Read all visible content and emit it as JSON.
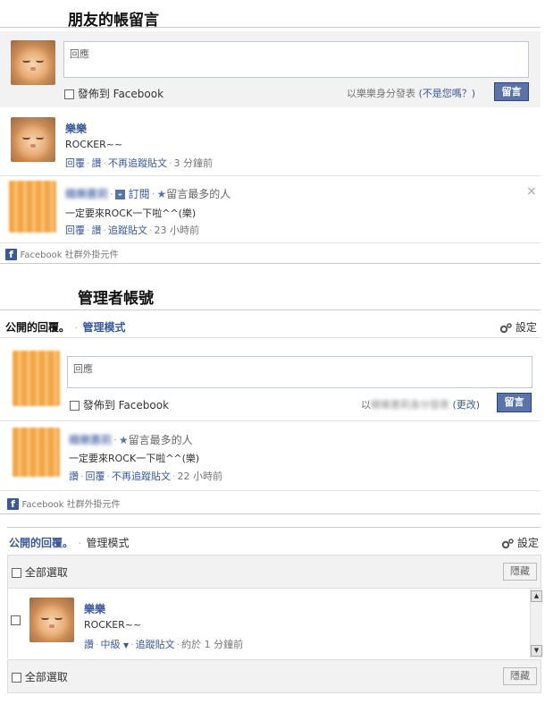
{
  "s1": {
    "title": "朋友的帳留言",
    "input_placeholder": "回應",
    "post_to_fb": "發佈到 Facebook",
    "posting_as": "以樂樂身分發表",
    "not_you": "(不是您嗎？)",
    "submit": "留言",
    "comments": [
      {
        "name": "樂樂",
        "text": "ROCKER~~",
        "actions": [
          "回覆",
          "讚",
          "不再追蹤貼文"
        ],
        "time": "3 分鐘前"
      },
      {
        "name": "韓樂惠莉",
        "subscribe": "訂閱",
        "badge": "留言最多的人",
        "text": "一定要來ROCK一下啦^^(樂)",
        "actions": [
          "回覆",
          "讚",
          "追蹤貼文"
        ],
        "time": "23 小時前"
      }
    ],
    "close": "×",
    "plugin": "Facebook 社群外掛元件"
  },
  "s2": {
    "title": "管理者帳號",
    "tab_public": "公開的回覆。",
    "tab_admin": "管理模式",
    "settings": "設定",
    "input_placeholder": "回應",
    "post_to_fb": "發佈到 Facebook",
    "posting_as_prefix": "以",
    "posting_as_name": "韓樂惠莉身分發表",
    "change": "(更改)",
    "submit": "留言",
    "comment": {
      "name": "韓樂惠莉",
      "badge": "留言最多的人",
      "text": "一定要來ROCK一下啦^^(樂)",
      "actions": [
        "讚",
        "回覆",
        "不再追蹤貼文"
      ],
      "time": "22 小時前"
    },
    "plugin": "Facebook 社群外掛元件"
  },
  "s3": {
    "tab_public": "公開的回覆。",
    "tab_admin": "管理模式",
    "settings": "設定",
    "select_all": "全部選取",
    "hide": "隱藏",
    "comment": {
      "name": "樂樂",
      "text": "ROCKER~~",
      "like": "讚",
      "level": "中級",
      "follow": "追蹤貼文",
      "time": "約於 1 分鐘前"
    }
  },
  "icons": [
    "facebook-icon",
    "rss-icon",
    "star-icon",
    "gear-icon",
    "close-icon",
    "scroll-up-icon",
    "scroll-down-icon",
    "dropdown-arrow-icon"
  ]
}
